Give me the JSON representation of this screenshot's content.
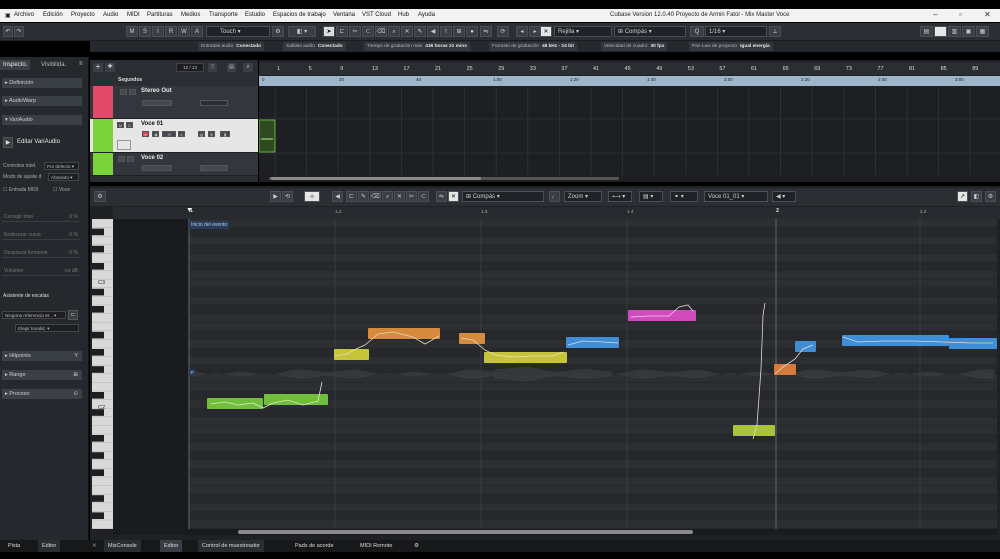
{
  "menu": {
    "items": [
      "Archivo",
      "Edición",
      "Proyecto",
      "Audio",
      "MIDI",
      "Partituras",
      "Medios",
      "Transporte",
      "Estudio",
      "Espacios de trabajo",
      "Ventana",
      "VST Cloud",
      "Hub",
      "Ayuda"
    ],
    "window_title": "Cubase Version 12.0.40 Proyecto de Armin Fatol - Mix Master Voce"
  },
  "toolbar": {
    "mode_buttons": [
      "M",
      "S",
      "I",
      "R",
      "W",
      "A"
    ],
    "automation_mode": "Touch",
    "snap_label": "Rejilla",
    "grid_type": "Compás",
    "quantize": "1/16"
  },
  "status": [
    {
      "label": "Entradas audio",
      "value": "Conectado"
    },
    {
      "label": "Salidas audio",
      "value": "Conectado"
    },
    {
      "label": "Tiempo de grabación máx",
      "value": "436 horas 21 mins"
    },
    {
      "label": "Formato de grabación",
      "value": "48 kHz - 24 bit"
    },
    {
      "label": "Velocidad de cuadro",
      "value": "30 fps"
    },
    {
      "label": "Pan Law de proyecto",
      "value": "Igual energía"
    }
  ],
  "inspector": {
    "tabs": [
      "Inspecto.",
      "Visibilida."
    ],
    "sections": [
      "Definición",
      "AudioWarp",
      "VariAudio"
    ],
    "edit_button": "Editar VariAudio",
    "controls_label": "Controles intel.",
    "controls_value": "Por defecto",
    "adjust_label": "Modo de ajuste d",
    "adjust_value": "Absoluto",
    "midi_input": "Entrada MIDI",
    "voice": "Voce",
    "fields": [
      {
        "label": "Corregir tono",
        "value": "0 %"
      },
      {
        "label": "Enderezar curva",
        "value": "0 %"
      },
      {
        "label": "Desplazar formante",
        "value": "0 %"
      },
      {
        "label": "Volumen",
        "value": "-oo dB"
      }
    ],
    "scale_assistant": "Asistente de escalas",
    "scale_ref": "Ninguna referencia M...",
    "scale_choose": "Elegir tonalid.",
    "bottom_sections": [
      "Hitpoints",
      "Rango",
      "Proceso"
    ]
  },
  "tracklist": {
    "counter": "12 / 12",
    "header": "Segundos",
    "tracks": [
      {
        "name": "Stereo Out",
        "color": "#e24a6a"
      },
      {
        "name": "Voce 01",
        "color": "#7bd33c"
      },
      {
        "name": "Voce 02",
        "color": "#7bd33c"
      }
    ]
  },
  "project_ruler": {
    "bars": [
      "1",
      "5",
      "9",
      "13",
      "17",
      "21",
      "25",
      "29",
      "33",
      "37",
      "41",
      "45",
      "49",
      "53",
      "57",
      "61",
      "65",
      "69",
      "73",
      "77",
      "81",
      "85",
      "89"
    ],
    "seconds": [
      "0",
      "20",
      "40",
      "1:00",
      "1:20",
      "1:40",
      "2:00",
      "2:20",
      "2:40",
      "3:00"
    ]
  },
  "editor": {
    "grid_type": "Compás",
    "zoom": "Zoom",
    "event": "Voce 01_01",
    "ruler": [
      "1",
      "1.2",
      "1.3",
      "1.4",
      "2",
      "2.2"
    ],
    "event_start": "Inicio del evento",
    "keys": [
      "C3",
      "C2"
    ]
  },
  "colors": {
    "green": "#6fbf3a",
    "yellow": "#c6c43a",
    "orange": "#d68a3e",
    "blue": "#3f8ed6",
    "magenta": "#d14bbf",
    "lime": "#a7c43a"
  },
  "bottom_tabs": [
    "Pista",
    "Editor",
    "MixConsole",
    "Editor",
    "Control de muestreador",
    "Pads de acorde",
    "MIDI Remote"
  ]
}
